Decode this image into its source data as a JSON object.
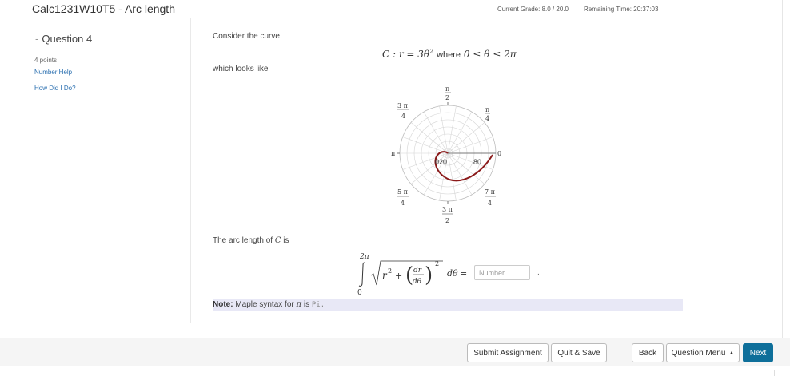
{
  "header": {
    "title": "Calc1231W10T5 - Arc length",
    "grade": "Current Grade: 8.0 / 20.0",
    "remaining": "Remaining Time: 20:37:03"
  },
  "sidebar": {
    "question": "Question 4",
    "points": "4 points",
    "help_link": "Number Help",
    "how_link": "How Did I Do?"
  },
  "question": {
    "intro": "Consider the curve",
    "curve_lhs": "C : r = 3θ",
    "curve_exp": "2",
    "curve_where": "where",
    "curve_range": "0 ≤ θ ≤ 2π",
    "looks_like": "which looks like",
    "arc_text": "The arc length of",
    "arc_C": "C",
    "arc_is": "is",
    "integral_upper": "2π",
    "integral_lower": "0",
    "answer_placeholder": "Number",
    "period": "."
  },
  "graph": {
    "labels": {
      "pi_over_2": [
        "π",
        "2"
      ],
      "three_pi_over_4": [
        "3 π",
        "4"
      ],
      "pi_over_4": [
        "π",
        "4"
      ],
      "pi": "π",
      "zero": "0",
      "five_pi_over_4": [
        "5 π",
        "4"
      ],
      "three_pi_over_2": [
        "3 π",
        "2"
      ],
      "seven_pi_over_4": [
        "7 π",
        "4"
      ],
      "r_tick_1": "020",
      "r_tick_2": "80"
    },
    "curve_color": "#8b1a1a"
  },
  "note": {
    "bold": "Note:",
    "text": "Maple syntax for",
    "pi": "π",
    "is": "is",
    "code": "Pi."
  },
  "footer": {
    "submit": "Submit Assignment",
    "quit": "Quit & Save",
    "back": "Back",
    "menu": "Question Menu",
    "next": "Next"
  },
  "colors": {
    "accent": "#0e6f9a",
    "link": "#2a6fb0",
    "note_bg": "#e8e8f6"
  }
}
